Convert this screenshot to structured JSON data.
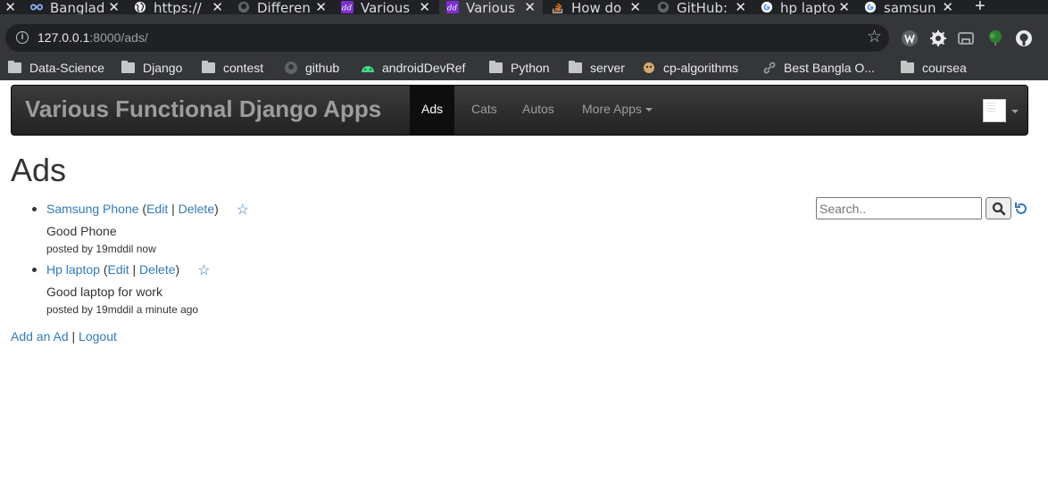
{
  "browser": {
    "tabs": [
      {
        "title": "Banglade",
        "icon": "infinity-icon",
        "active": false
      },
      {
        "title": "https://",
        "icon": "globe-icon",
        "active": false
      },
      {
        "title": "Differen",
        "icon": "github-icon",
        "active": false
      },
      {
        "title": "Various",
        "icon": "dd-icon",
        "active": false
      },
      {
        "title": "Various",
        "icon": "dd-icon",
        "active": true
      },
      {
        "title": "How do",
        "icon": "stackoverflow-icon",
        "active": false
      },
      {
        "title": "GitHub:",
        "icon": "github-icon",
        "active": false
      },
      {
        "title": "hp lapto",
        "icon": "google-icon",
        "active": false
      },
      {
        "title": "samsun",
        "icon": "google-icon",
        "active": false
      }
    ],
    "url_host": "127.0.0.1",
    "url_rest": ":8000/ads/",
    "bookmarks": [
      {
        "label": "Data-Science",
        "icon": "folder-icon"
      },
      {
        "label": "Django",
        "icon": "folder-icon"
      },
      {
        "label": "contest",
        "icon": "folder-icon"
      },
      {
        "label": "github",
        "icon": "github-icon"
      },
      {
        "label": "androidDevRef",
        "icon": "android-icon"
      },
      {
        "label": "Python",
        "icon": "folder-icon"
      },
      {
        "label": "server",
        "icon": "folder-icon"
      },
      {
        "label": "cp-algorithms",
        "icon": "cp-icon"
      },
      {
        "label": "Best Bangla O...",
        "icon": "link-icon"
      },
      {
        "label": "coursea",
        "icon": "folder-icon"
      }
    ]
  },
  "navbar": {
    "brand": "Various Functional Django Apps",
    "links": [
      {
        "label": "Ads",
        "active": true
      },
      {
        "label": "Cats",
        "active": false
      },
      {
        "label": "Autos",
        "active": false
      },
      {
        "label": "More Apps",
        "active": false
      }
    ]
  },
  "page": {
    "title": "Ads",
    "search_placeholder": "Search..",
    "ads": [
      {
        "title": "Samsung Phone",
        "edit": "Edit",
        "delete": "Delete",
        "text": "Good Phone",
        "meta": "posted by 19mddil now"
      },
      {
        "title": "Hp laptop",
        "edit": "Edit",
        "delete": "Delete",
        "text": "Good laptop for work",
        "meta": "posted by 19mddil a minute ago"
      }
    ],
    "footer": {
      "add": "Add an Ad",
      "logout": "Logout",
      "sep": "|"
    }
  }
}
